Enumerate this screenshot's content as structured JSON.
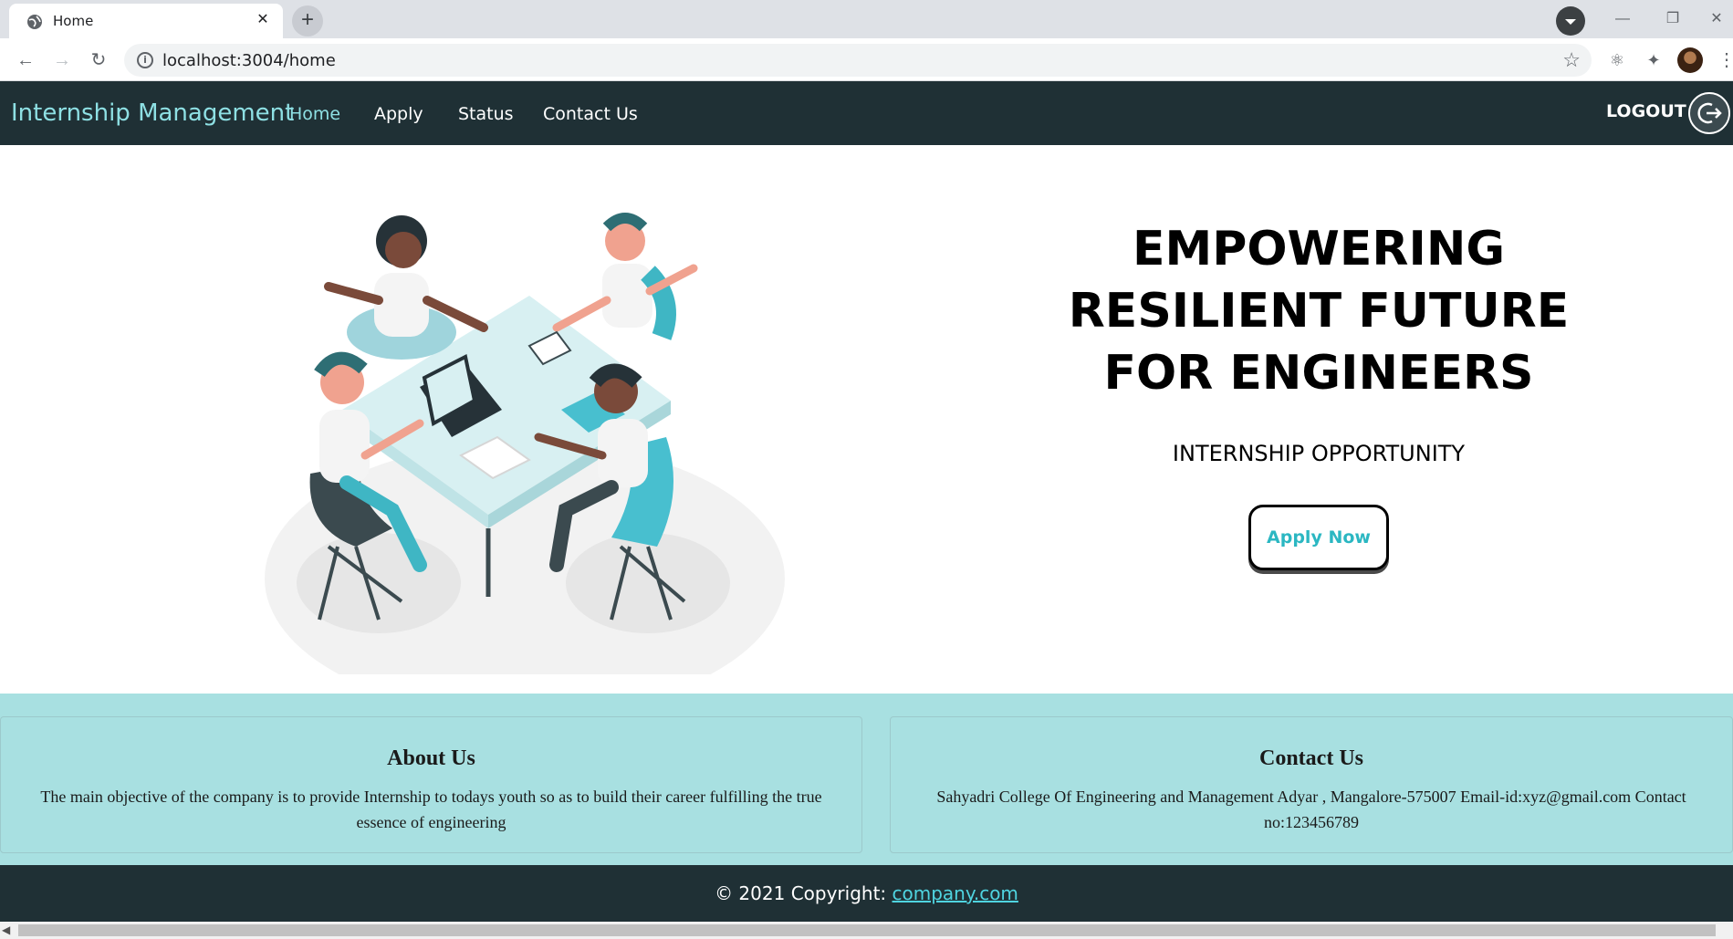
{
  "browser": {
    "tab_title": "Home",
    "tab_close": "✕",
    "new_tab": "+",
    "url": "localhost:3004/home",
    "window_controls": [
      "—",
      "❐",
      "✕"
    ]
  },
  "nav": {
    "brand": "Internship Management",
    "links": [
      {
        "label": "Home",
        "active": true
      },
      {
        "label": "Apply",
        "active": false
      },
      {
        "label": "Status",
        "active": false
      },
      {
        "label": "Contact Us",
        "active": false
      }
    ],
    "logout": "LOGOUT"
  },
  "hero": {
    "title_lines": [
      "EMPOWERING",
      "RESILIENT FUTURE",
      "FOR ENGINEERS"
    ],
    "subtitle": "INTERNSHIP OPPORTUNITY",
    "cta": "Apply Now"
  },
  "about": {
    "title": "About Us",
    "text": "The main objective of the company is to provide Internship to todays youth so as to build their career fulfilling the true essence of engineering"
  },
  "contact": {
    "title": "Contact Us",
    "text": "Sahyadri College Of Engineering and Management Adyar , Mangalore-575007 Email-id:xyz@gmail.com Contact no:123456789"
  },
  "footer": {
    "prefix": "© 2021 Copyright: ",
    "link": "company.com"
  },
  "colors": {
    "nav_bg": "#1f3035",
    "accent": "#8ee0e4",
    "band_bg": "#a8e0e1",
    "button_text": "#2bb7c2"
  }
}
